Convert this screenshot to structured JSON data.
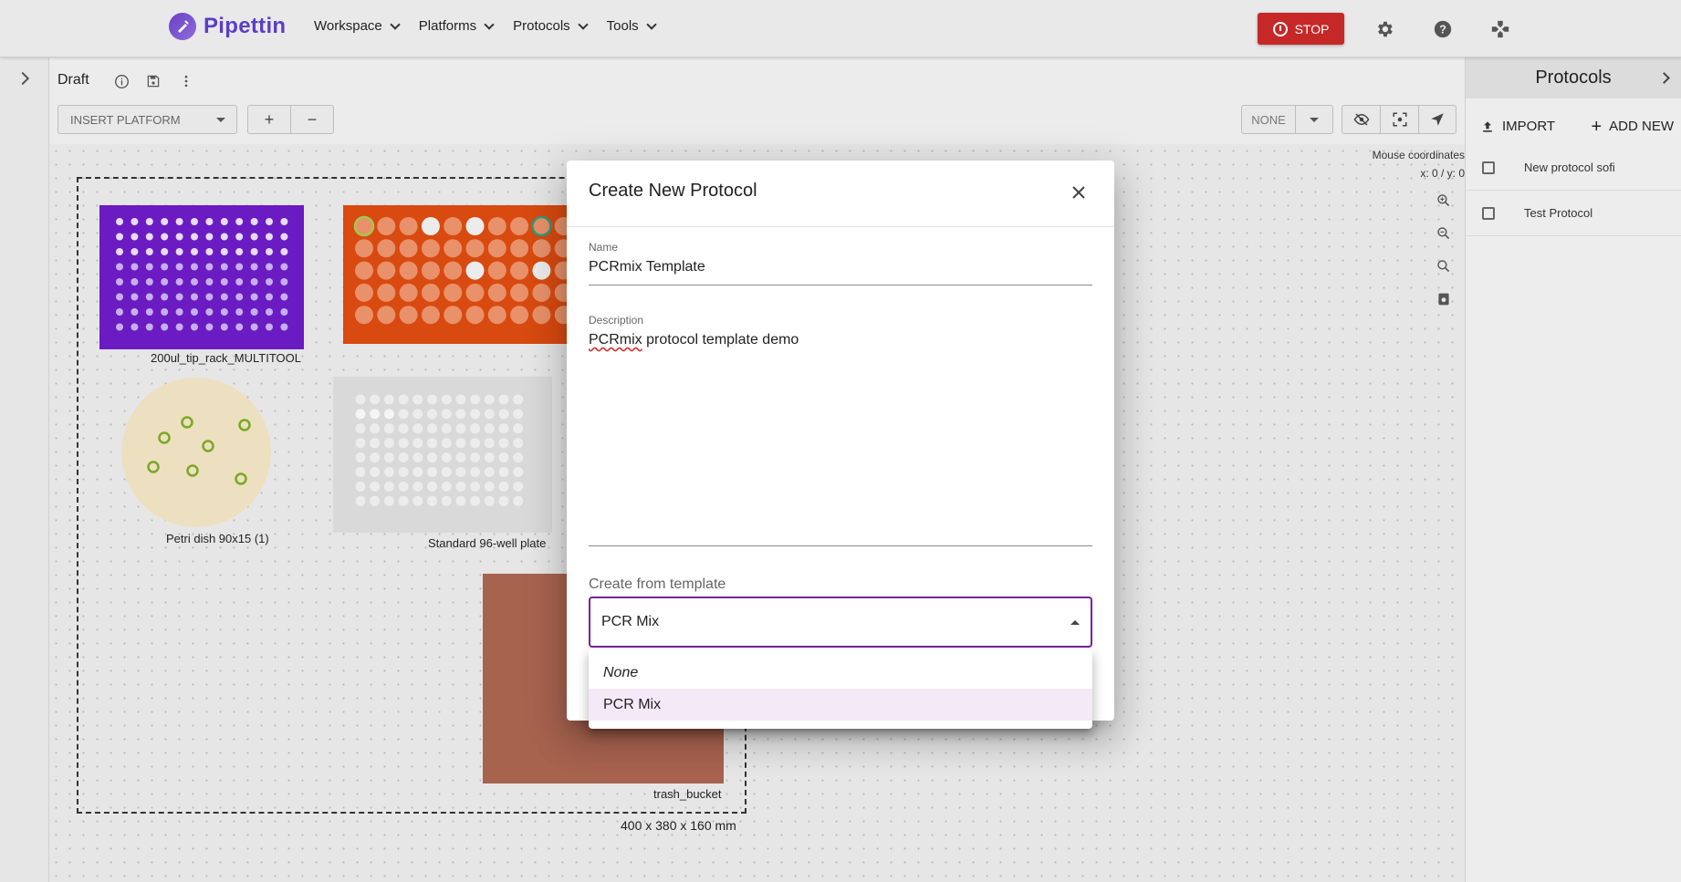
{
  "app": {
    "name": "Pipettin",
    "nav": [
      "Workspace",
      "Platforms",
      "Protocols",
      "Tools"
    ],
    "stop_label": "STOP"
  },
  "workspace": {
    "title": "Draft",
    "insert_platform_label": "INSERT PLATFORM",
    "add_label": "+",
    "remove_label": "−",
    "view_mode": "NONE",
    "mouse_coords_title": "Mouse coordinates",
    "mouse_coords_value": "x: 0 / y: 0",
    "dimensions": "400 x 380 x 160 mm",
    "platforms": [
      {
        "label": "200ul_tip_rack_MULTITOOL",
        "color": "#6a1bc2"
      },
      {
        "label": "Petri dish 90x15 (1)",
        "color": "#ece0c0"
      },
      {
        "label": "Standard 96-well plate",
        "color": "#d9d9d9"
      },
      {
        "label": "trash_bucket",
        "color": "#a8634f"
      },
      {
        "label": "",
        "color": "#d84a10"
      }
    ]
  },
  "right_panel": {
    "title": "Protocols",
    "import_label": "IMPORT",
    "add_new_label": "ADD NEW",
    "items": [
      "New protocol sofi",
      "Test Protocol"
    ]
  },
  "dialog": {
    "title": "Create New Protocol",
    "name_label": "Name",
    "name_value": "PCRmix Template",
    "description_label": "Description",
    "description_first_word": "PCRmix",
    "description_rest": " protocol template demo",
    "template_label": "Create from template",
    "template_value": "PCR Mix",
    "template_options": [
      "None",
      "PCR Mix"
    ],
    "accent_color": "#7b1fa2"
  }
}
